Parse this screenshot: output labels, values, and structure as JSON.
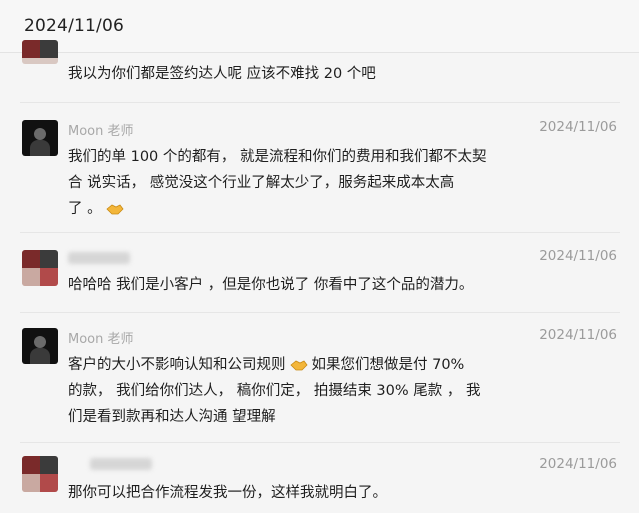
{
  "header": {
    "date": "2024/11/06"
  },
  "messages": [
    {
      "sender": "",
      "time": "",
      "text": "我以为你们都是签约达人呢 应该不难找 20 个吧"
    },
    {
      "sender": "Moon 老师",
      "time": "2024/11/06",
      "lines": [
        "我们的单 100 个的都有， 就是流程和你们的费用和我们都不太契",
        "合 说实话， 感觉没这个行业了解太少了，服务起来成本太高",
        "了 。"
      ]
    },
    {
      "sender": "",
      "time": "2024/11/06",
      "text": "哈哈哈 我们是小客户 ，但是你也说了 你看中了这个品的潜力。"
    },
    {
      "sender": "Moon 老师",
      "time": "2024/11/06",
      "lines": [
        "客户的大小不影响认知和公司规则",
        "如果您们想做是付 70%",
        "的款， 我们给你们达人， 稿你们定， 拍摄结束 30% 尾款 ， 我",
        "们是看到款再和达人沟通 望理解"
      ]
    },
    {
      "sender": "",
      "time": "2024/11/06",
      "text": "那你可以把合作流程发我一份，这样我就明白了。"
    }
  ],
  "icons": {
    "handshake": "handshake-emoji-icon"
  }
}
